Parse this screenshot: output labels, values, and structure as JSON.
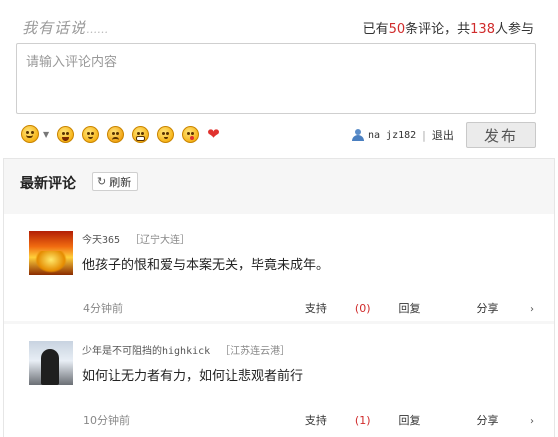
{
  "header": {
    "title": "我有话说",
    "title_dots": "……",
    "stats_prefix": "已有",
    "comment_count": "50",
    "stats_mid": "条评论，共",
    "participant_count": "138",
    "stats_suffix": "人参与"
  },
  "editor": {
    "placeholder": "请输入评论内容",
    "value": ""
  },
  "emoticons": [
    "smile-icon",
    "laugh-icon",
    "thinking-icon",
    "cry-icon",
    "grin-icon",
    "shy-icon",
    "kiss-icon",
    "heart-icon"
  ],
  "user": {
    "name": "na jz182",
    "separator": "|",
    "logout_label": "退出"
  },
  "publish_label": "发布",
  "list": {
    "title": "最新评论",
    "refresh_label": "刷新",
    "items": [
      {
        "username": "今天365",
        "location": "［辽宁大连］",
        "text": "他孩子的恨和爱与本案无关，毕竟未成年。",
        "time": "4分钟前",
        "support_label": "支持",
        "support_count": "(0)",
        "reply_label": "回复",
        "share_label": "分享"
      },
      {
        "username": "少年是不可阻挡的highkick",
        "location": "［江苏连云港］",
        "text": "如何让无力者有力，如何让悲观者前行",
        "time": "10分钟前",
        "support_label": "支持",
        "support_count": "(1)",
        "reply_label": "回复",
        "share_label": "分享"
      }
    ]
  },
  "colors": {
    "accent_red": "#d02b2b",
    "list_background": "#f6f6f6"
  }
}
